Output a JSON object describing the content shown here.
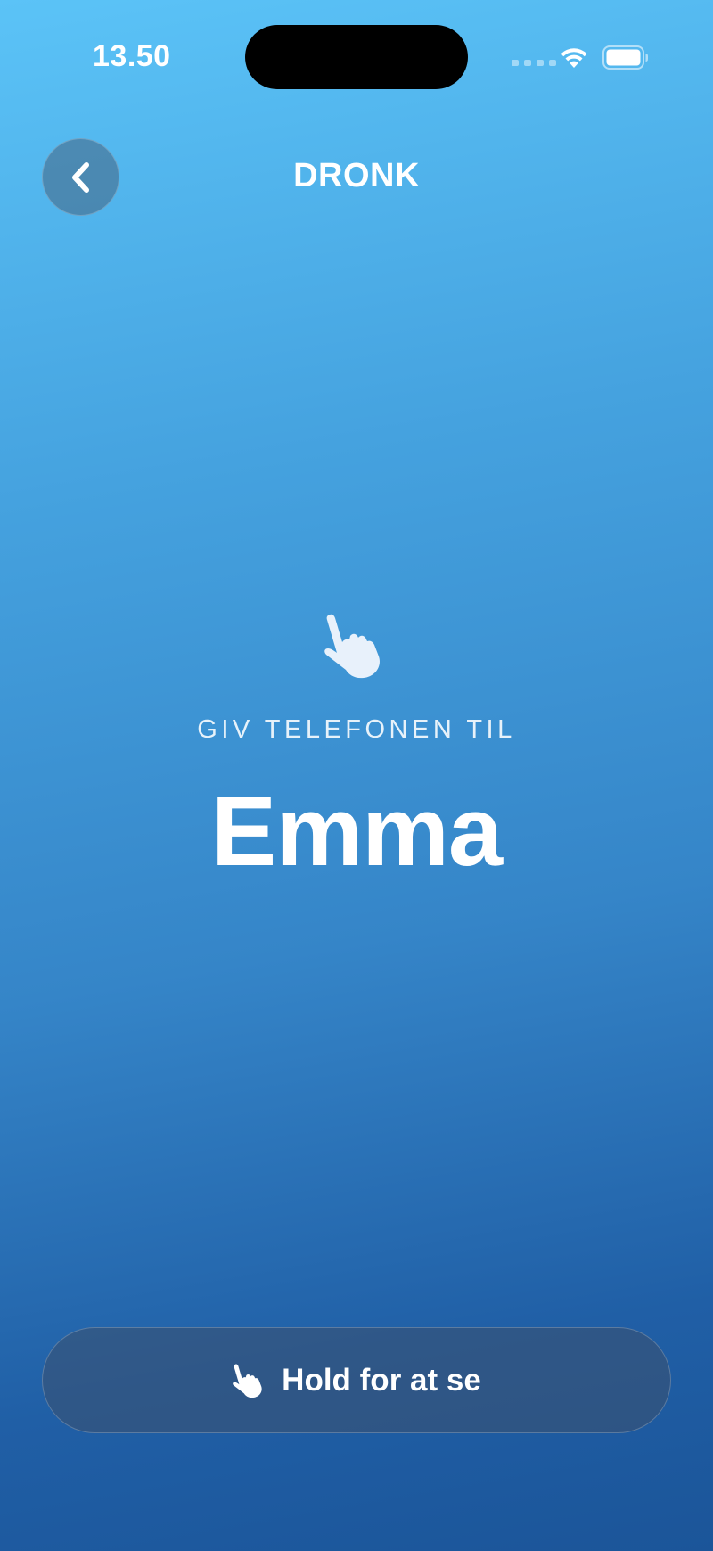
{
  "status_bar": {
    "time": "13.50"
  },
  "header": {
    "title": "DRONK",
    "back_icon": "chevron-left-icon"
  },
  "handoff": {
    "icon": "hand-point-up-icon",
    "label": "GIV TELEFONEN TIL",
    "player_name": "Emma"
  },
  "hold_button": {
    "icon": "hand-point-up-icon",
    "label": "Hold for at se"
  },
  "colors": {
    "gradient_top": "#5bc3f7",
    "gradient_bottom": "#1b5599",
    "text": "#ffffff"
  }
}
